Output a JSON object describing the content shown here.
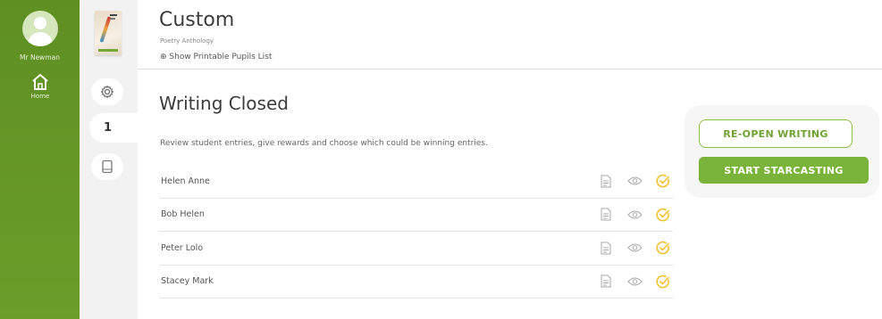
{
  "sidebar": {
    "user_name": "Mr Newman",
    "home_label": "Home"
  },
  "subnav": {
    "tab_label": "1"
  },
  "header": {
    "title": "Custom",
    "subtitle": "Poetry Anthology",
    "printable_link": "⊕ Show Printable Pupils List"
  },
  "main": {
    "section_title": "Writing Closed",
    "instructions": "Review student entries, give rewards and choose which could be winning entries.",
    "students": [
      {
        "name": "Helen Anne"
      },
      {
        "name": "Bob Helen"
      },
      {
        "name": "Peter Lolo"
      },
      {
        "name": "Stacey Mark"
      }
    ]
  },
  "actions": {
    "reopen_label": "RE-OPEN WRITING",
    "start_label": "START STARCASTING"
  },
  "colors": {
    "brand_green": "#6a9d2a",
    "button_green": "#7ab33a",
    "check_yellow": "#f2c230"
  },
  "icons": [
    "user-avatar-icon",
    "home-icon",
    "gear-icon",
    "file-icon",
    "document-icon",
    "eye-icon",
    "check-circle-icon"
  ]
}
